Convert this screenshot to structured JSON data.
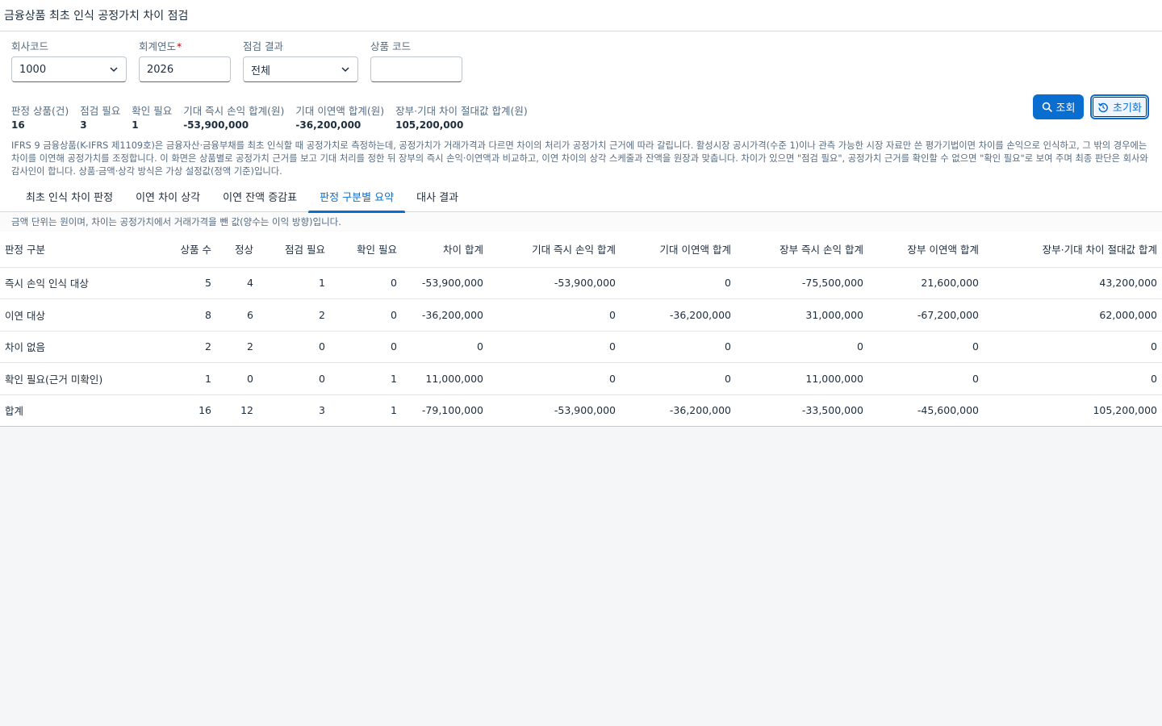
{
  "page": {
    "title": "금융상품 최초 인식 공정가치 차이 점검"
  },
  "filters": {
    "company": {
      "label": "회사코드",
      "value": "1000"
    },
    "year": {
      "label": "회계연도",
      "required_mark": "*",
      "value": "2026"
    },
    "result": {
      "label": "점검 결과",
      "value": "전체"
    },
    "product": {
      "label": "상품 코드",
      "value": ""
    }
  },
  "buttons": {
    "search": "조회",
    "reset": "초기화"
  },
  "kpis": [
    {
      "label": "판정 상품(건)",
      "value": "16"
    },
    {
      "label": "점검 필요",
      "value": "3"
    },
    {
      "label": "확인 필요",
      "value": "1"
    },
    {
      "label": "기대 즉시 손익 합계(원)",
      "value": "-53,900,000"
    },
    {
      "label": "기대 이연액 합계(원)",
      "value": "-36,200,000"
    },
    {
      "label": "장부·기대 차이 절대값 합계(원)",
      "value": "105,200,000"
    }
  ],
  "description": "IFRS 9 금융상품(K-IFRS 제1109호)은 금융자산·금융부채를 최초 인식할 때 공정가치로 측정하는데, 공정가치가 거래가격과 다르면 차이의 처리가 공정가치 근거에 따라 갈립니다. 활성시장 공시가격(수준 1)이나 관측 가능한 시장 자료만 쓴 평가기법이면 차이를 손익으로 인식하고, 그 밖의 경우에는 차이를 이연해 공정가치를 조정합니다. 이 화면은 상품별로 공정가치 근거를 보고 기대 처리를 정한 뒤 장부의 즉시 손익·이연액과 비교하고, 이연 차이의 상각 스케줄과 잔액을 원장과 맞춥니다. 차이가 있으면 \"점검 필요\", 공정가치 근거를 확인할 수 없으면 \"확인 필요\"로 보여 주며 최종 판단은 회사와 감사인이 합니다. 상품·금액·상각 방식은 가상 설정값(정액 기준)입니다.",
  "tabs": [
    {
      "label": "최초 인식 차이 판정"
    },
    {
      "label": "이연 차이 상각"
    },
    {
      "label": "이연 잔액 증감표"
    },
    {
      "label": "판정 구분별 요약"
    },
    {
      "label": "대사 결과"
    }
  ],
  "note": "금액 단위는 원이며, 차이는 공정가치에서 거래가격을 뺀 값(양수는 이익 방향)입니다.",
  "table": {
    "headers": [
      "판정 구분",
      "상품 수",
      "정상",
      "점검 필요",
      "확인 필요",
      "차이 합계",
      "기대 즉시 손익 합계",
      "기대 이연액 합계",
      "장부 즉시 손익 합계",
      "장부 이연액 합계",
      "장부·기대 차이 절대값 합계"
    ],
    "rows": [
      [
        "즉시 손익 인식 대상",
        "5",
        "4",
        "1",
        "0",
        "-53,900,000",
        "-53,900,000",
        "0",
        "-75,500,000",
        "21,600,000",
        "43,200,000"
      ],
      [
        "이연 대상",
        "8",
        "6",
        "2",
        "0",
        "-36,200,000",
        "0",
        "-36,200,000",
        "31,000,000",
        "-67,200,000",
        "62,000,000"
      ],
      [
        "차이 없음",
        "2",
        "2",
        "0",
        "0",
        "0",
        "0",
        "0",
        "0",
        "0",
        "0"
      ],
      [
        "확인 필요(근거 미확인)",
        "1",
        "0",
        "0",
        "1",
        "11,000,000",
        "0",
        "0",
        "11,000,000",
        "0",
        "0"
      ],
      [
        "합계",
        "16",
        "12",
        "3",
        "1",
        "-79,100,000",
        "-53,900,000",
        "-36,200,000",
        "-33,500,000",
        "-45,600,000",
        "105,200,000"
      ]
    ]
  },
  "colors": {
    "accent": "#0a6ed1",
    "warning_text": "#b05e00",
    "required": "#aa0808"
  }
}
